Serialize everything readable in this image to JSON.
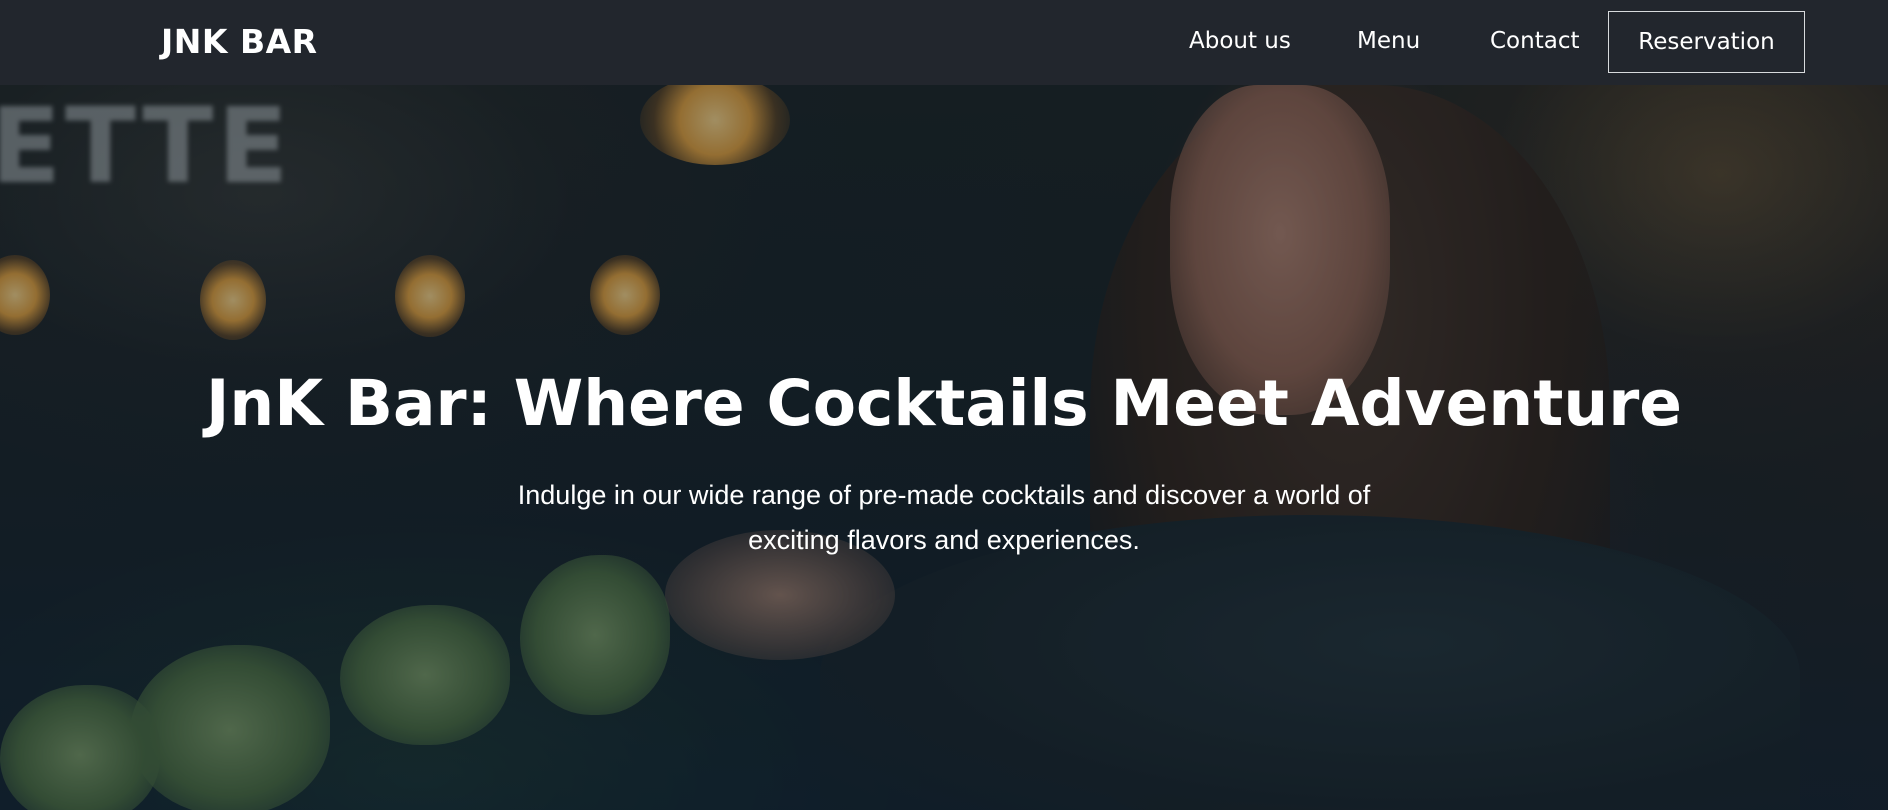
{
  "nav": {
    "brand": "JNK BAR",
    "links": [
      "About us",
      "Menu",
      "Contact"
    ],
    "cta_label": "Reservation"
  },
  "hero": {
    "title": "JnK Bar: Where Cocktails Meet Adventure",
    "subtitle": "Indulge in our wide range of pre-made cocktails and discover a world of exciting flavors and experiences.",
    "background_image": "woman-eating-at-bar-photo"
  },
  "colors": {
    "navbar_bg": "#22262d",
    "text": "#ffffff",
    "overlay": "#0f2236"
  }
}
